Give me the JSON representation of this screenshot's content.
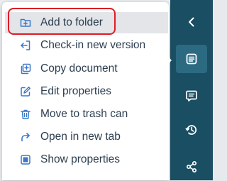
{
  "context_menu": {
    "items": [
      {
        "label": "Add to folder",
        "icon": "folder-plus-icon"
      },
      {
        "label": "Check-in new version",
        "icon": "check-in-icon"
      },
      {
        "label": "Copy document",
        "icon": "copy-plus-icon"
      },
      {
        "label": "Edit properties",
        "icon": "edit-icon"
      },
      {
        "label": "Move to trash can",
        "icon": "trash-icon"
      },
      {
        "label": "Open in new tab",
        "icon": "open-tab-arrow-icon"
      },
      {
        "label": "Show properties",
        "icon": "properties-icon"
      }
    ],
    "highlighted_index": 0
  },
  "side_rail": {
    "buttons": [
      "collapse-chevron-icon",
      "document-details-icon",
      "comments-icon",
      "history-icon",
      "share-icon"
    ],
    "active_index": 1
  },
  "colors": {
    "accent_blue": "#3a78c9",
    "rail_bg": "#194e63",
    "rail_active": "#2c6a82",
    "highlight_ring": "#e01b24",
    "text": "#2c3e50"
  }
}
